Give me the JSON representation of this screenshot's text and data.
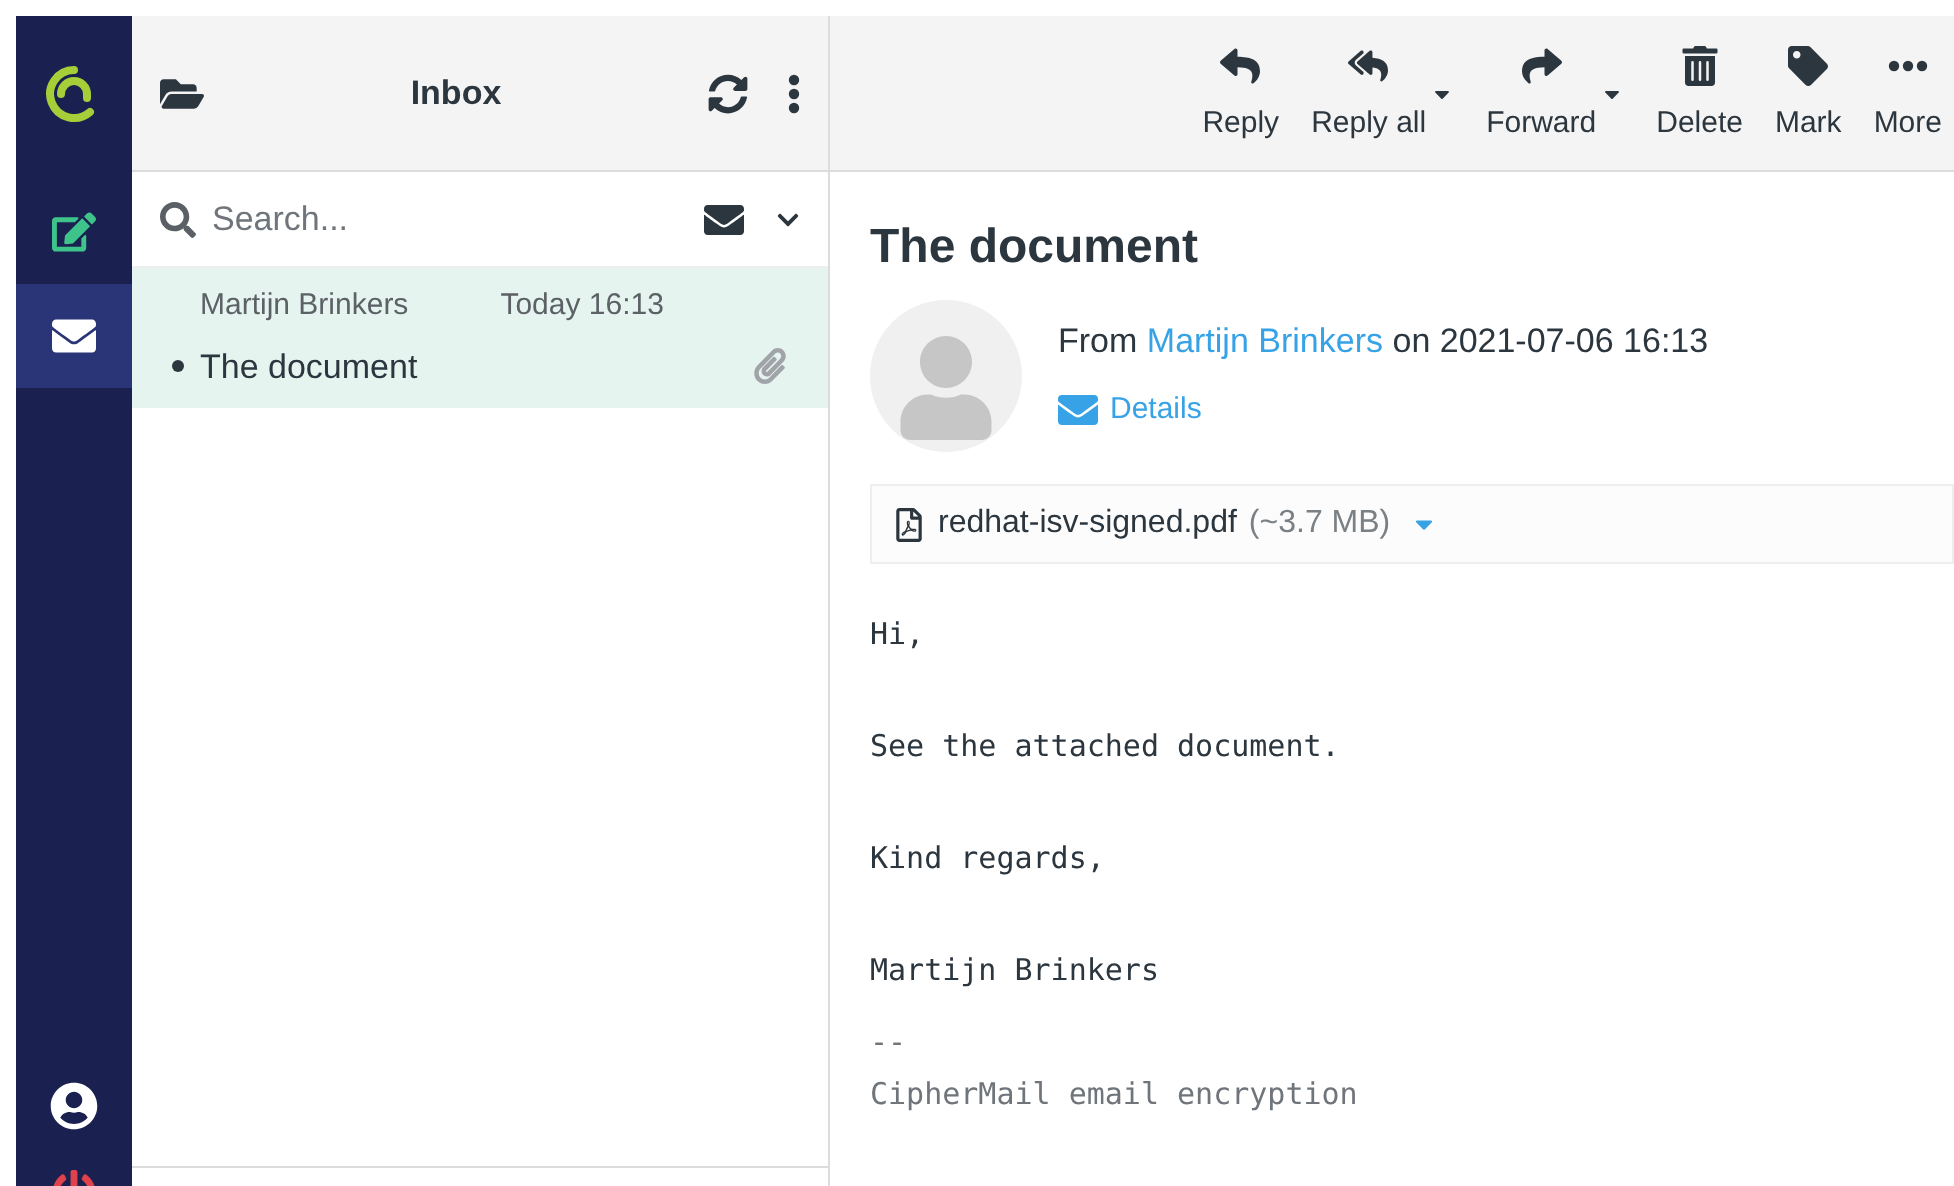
{
  "nav": {
    "items": [
      {
        "kind": "compose",
        "selected": false
      },
      {
        "kind": "mail",
        "selected": true
      }
    ]
  },
  "folder": {
    "title": "Inbox"
  },
  "search": {
    "placeholder": "Search..."
  },
  "messages": [
    {
      "sender": "Martijn Brinkers",
      "date": "Today 16:13",
      "subject": "The document",
      "unread": true,
      "attachment": true,
      "selected": true
    }
  ],
  "toolbar": [
    {
      "kind": "reply",
      "label": "Reply",
      "dropdown": false
    },
    {
      "kind": "reply-all",
      "label": "Reply all",
      "dropdown": true
    },
    {
      "kind": "forward",
      "label": "Forward",
      "dropdown": true
    },
    {
      "kind": "delete",
      "label": "Delete",
      "dropdown": false
    },
    {
      "kind": "mark",
      "label": "Mark",
      "dropdown": false
    },
    {
      "kind": "more",
      "label": "More",
      "dropdown": false
    }
  ],
  "mail": {
    "subject": "The document",
    "from_label": "From",
    "sender": "Martijn Brinkers",
    "on_label": "on 2021-07-06 16:13",
    "details": "Details",
    "attachment": {
      "name": "redhat-isv-signed.pdf",
      "size": "(~3.7 MB)"
    },
    "body": [
      {
        "text": "Hi,",
        "kind": "text"
      },
      {
        "text": "See the attached document.",
        "kind": "text"
      },
      {
        "text": "Kind regards,",
        "kind": "text"
      },
      {
        "text": "Martijn Brinkers",
        "kind": "text"
      },
      {
        "text": "--",
        "kind": "signature"
      },
      {
        "text": "CipherMail email encryption",
        "kind": "signature"
      }
    ]
  }
}
